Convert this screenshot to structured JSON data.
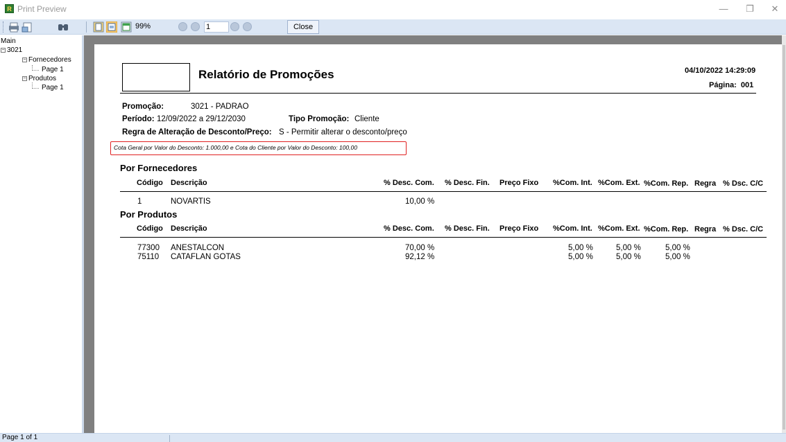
{
  "window": {
    "title": "Print Preview",
    "app_icon": "R",
    "minimize_glyph": "—",
    "maximize_glyph": "❐",
    "close_glyph": "✕"
  },
  "toolbar": {
    "icons": [
      "print-icon",
      "page-setup-icon",
      "find-icon",
      "single-page-icon",
      "fit-page-icon",
      "whole-page-icon"
    ],
    "zoom": "99%",
    "page_input": "1",
    "close_label": "Close"
  },
  "tree": {
    "root": "Main",
    "node": "3021",
    "fornecedores": "Fornecedores",
    "fornecedores_page": "Page 1",
    "produtos": "Produtos",
    "produtos_page": "Page 1"
  },
  "report": {
    "title": "Relatório de  Promoções",
    "datetime": "04/10/2022 14:29:09",
    "pagina_label": "Página:",
    "pagina_value": "001",
    "promocao_label": "Promoção:",
    "promocao_value": "3021 -  PADRAO",
    "periodo_label": "Período:",
    "periodo_value": "12/09/2022  a  29/12/2030",
    "tipo_label": "Tipo Promoção:",
    "tipo_value": "Cliente",
    "regra_label": "Regra  de  Alteração de Desconto/Preço:",
    "regra_value": "S - Permitir alterar o desconto/preço",
    "cota_note": "Cota Geral por Valor do Desconto: 1.000,00 e Cota do Cliente por Valor do Desconto: 100,00"
  },
  "columns": {
    "codigo": "Código",
    "descricao": "Descrição",
    "desc_com": "% Desc. Com.",
    "desc_fin": "% Desc. Fin.",
    "preco_fixo": "Preço Fixo",
    "com_int": "%Com. Int.",
    "com_ext": "%Com. Ext.",
    "com_rep": "%Com. Rep.",
    "regra": "Regra",
    "dsc_cc": "% Dsc. C/C"
  },
  "fornecedores": {
    "heading": "Por Fornecedores",
    "rows": [
      {
        "codigo": "1",
        "descricao": "NOVARTIS",
        "desc_com": "10,00 %"
      }
    ]
  },
  "produtos": {
    "heading": "Por Produtos",
    "rows": [
      {
        "codigo": "77300",
        "descricao": "ANESTALCON",
        "desc_com": "70,00 %",
        "com_int": "5,00 %",
        "com_ext": "5,00 %",
        "com_rep": "5,00 %"
      },
      {
        "codigo": "75110",
        "descricao": "CATAFLAN GOTAS",
        "desc_com": "92,12 %",
        "com_int": "5,00 %",
        "com_ext": "5,00 %",
        "com_rep": "5,00 %"
      }
    ]
  },
  "status": {
    "page_of": "Page 1 of 1"
  }
}
